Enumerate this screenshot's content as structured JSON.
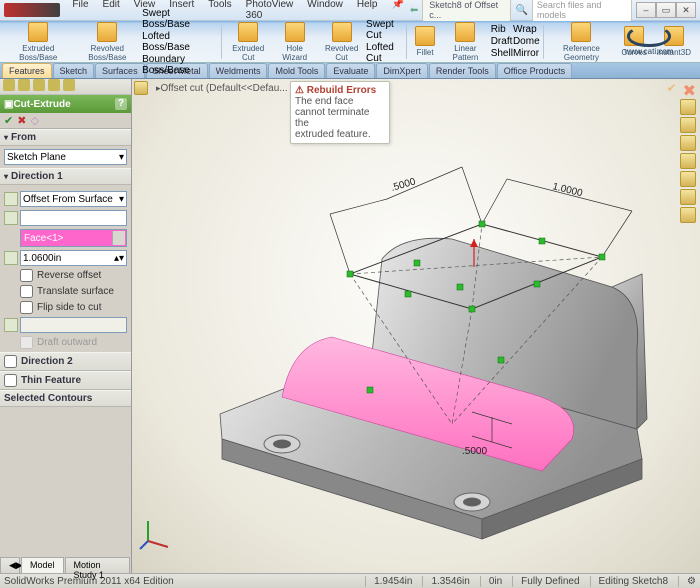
{
  "app": {
    "name": "SolidWorks"
  },
  "menus": [
    "File",
    "Edit",
    "View",
    "Insert",
    "Tools",
    "PhotoView 360",
    "Window",
    "Help"
  ],
  "breadcrumb": "Sketch8 of Offset c...",
  "search_placeholder": "Search files and models",
  "ribbon": [
    {
      "label": "Extruded\nBoss/Base"
    },
    {
      "label": "Revolved\nBoss/Base"
    },
    {
      "label": "Swept Boss/Base",
      "small": true
    },
    {
      "label": "Lofted Boss/Base",
      "small": true
    },
    {
      "label": "Boundary Boss/Base",
      "small": true
    },
    {
      "label": "Extruded\nCut"
    },
    {
      "label": "Hole\nWizard"
    },
    {
      "label": "Revolved\nCut"
    },
    {
      "label": "Swept Cut",
      "small": true
    },
    {
      "label": "Lofted Cut",
      "small": true
    },
    {
      "label": "Fillet"
    },
    {
      "label": "Linear\nPattern"
    },
    {
      "label": "Rib",
      "small": true
    },
    {
      "label": "Draft",
      "small": true
    },
    {
      "label": "Shell",
      "small": true
    },
    {
      "label": "Wrap",
      "small": true
    },
    {
      "label": "Dome",
      "small": true
    },
    {
      "label": "Mirror",
      "small": true
    },
    {
      "label": "Reference\nGeometry"
    },
    {
      "label": "Curves"
    },
    {
      "label": "Instant3D"
    }
  ],
  "watermark_url": "www.cati.com",
  "feature_tabs": [
    "Features",
    "Sketch",
    "Surfaces",
    "Sheet Metal",
    "Weldments",
    "Mold Tools",
    "Evaluate",
    "DimXpert",
    "Render Tools",
    "Office Products"
  ],
  "pm": {
    "title": "Cut-Extrude",
    "from_label": "From",
    "from_value": "Sketch Plane",
    "dir1_label": "Direction 1",
    "end_condition": "Offset From Surface",
    "face": "Face<1>",
    "offset": "1.0600in",
    "chk_reverse": "Reverse offset",
    "chk_translate": "Translate surface",
    "chk_flip": "Flip side to cut",
    "draft_outward": "Draft outward",
    "dir2_label": "Direction 2",
    "thin_label": "Thin Feature",
    "selcont_label": "Selected Contours"
  },
  "tree_node": "Offset cut (Default<<Defau...",
  "rebuild": {
    "title": "Rebuild Errors",
    "msg1": "The end face cannot terminate the",
    "msg2": "extruded feature."
  },
  "dims": {
    "d1": ".5000",
    "d2": "1.0000",
    "d3": ".5000"
  },
  "bottom_tabs": [
    "Model",
    "Motion Study 1"
  ],
  "status": {
    "text": "SolidWorks Premium 2011 x64 Edition",
    "coord1": "1.9454in",
    "coord2": "1.3546in",
    "coord3": "0in",
    "state1": "Fully Defined",
    "state2": "Editing Sketch8"
  }
}
